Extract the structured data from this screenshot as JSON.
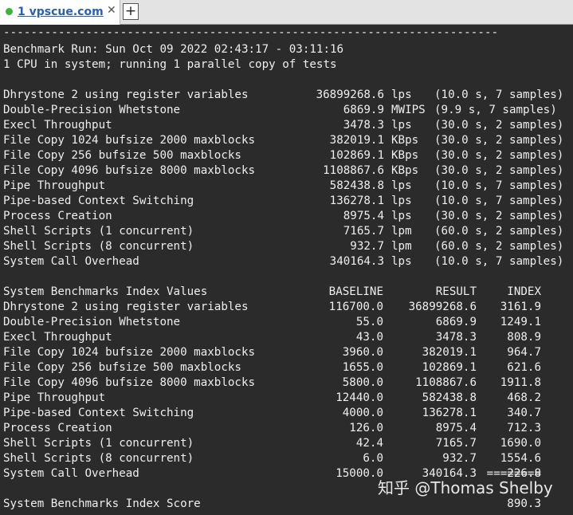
{
  "tab": {
    "title": "1 vpscue.com",
    "close": "✕",
    "new_tab": "+"
  },
  "header": {
    "separator": "------------------------------------------------------------------------",
    "run_line": "Benchmark Run: Sun Oct 09 2022 02:43:17 - 03:11:16",
    "cpu_line": "1 CPU in system; running 1 parallel copy of tests"
  },
  "results": [
    {
      "name": "Dhrystone 2 using register variables",
      "value": "36899268.6",
      "unit": "lps",
      "detail": "(10.0 s, 7 samples)"
    },
    {
      "name": "Double-Precision Whetstone",
      "value": "6869.9",
      "unit": "MWIPS",
      "detail": "(9.9 s, 7 samples)"
    },
    {
      "name": "Execl Throughput",
      "value": "3478.3",
      "unit": "lps",
      "detail": "(30.0 s, 2 samples)"
    },
    {
      "name": "File Copy 1024 bufsize 2000 maxblocks",
      "value": "382019.1",
      "unit": "KBps",
      "detail": "(30.0 s, 2 samples)"
    },
    {
      "name": "File Copy 256 bufsize 500 maxblocks",
      "value": "102869.1",
      "unit": "KBps",
      "detail": "(30.0 s, 2 samples)"
    },
    {
      "name": "File Copy 4096 bufsize 8000 maxblocks",
      "value": "1108867.6",
      "unit": "KBps",
      "detail": "(30.0 s, 2 samples)"
    },
    {
      "name": "Pipe Throughput",
      "value": "582438.8",
      "unit": "lps",
      "detail": "(10.0 s, 7 samples)"
    },
    {
      "name": "Pipe-based Context Switching",
      "value": "136278.1",
      "unit": "lps",
      "detail": "(10.0 s, 7 samples)"
    },
    {
      "name": "Process Creation",
      "value": "8975.4",
      "unit": "lps",
      "detail": "(30.0 s, 2 samples)"
    },
    {
      "name": "Shell Scripts (1 concurrent)",
      "value": "7165.7",
      "unit": "lpm",
      "detail": "(60.0 s, 2 samples)"
    },
    {
      "name": "Shell Scripts (8 concurrent)",
      "value": "932.7",
      "unit": "lpm",
      "detail": "(60.0 s, 2 samples)"
    },
    {
      "name": "System Call Overhead",
      "value": "340164.3",
      "unit": "lps",
      "detail": "(10.0 s, 7 samples)"
    }
  ],
  "index_header": {
    "title": "System Benchmarks Index Values",
    "baseline": "BASELINE",
    "result": "RESULT",
    "index": "INDEX"
  },
  "index_rows": [
    {
      "name": "Dhrystone 2 using register variables",
      "baseline": "116700.0",
      "result": "36899268.6",
      "index": "3161.9"
    },
    {
      "name": "Double-Precision Whetstone",
      "baseline": "55.0",
      "result": "6869.9",
      "index": "1249.1"
    },
    {
      "name": "Execl Throughput",
      "baseline": "43.0",
      "result": "3478.3",
      "index": "808.9"
    },
    {
      "name": "File Copy 1024 bufsize 2000 maxblocks",
      "baseline": "3960.0",
      "result": "382019.1",
      "index": "964.7"
    },
    {
      "name": "File Copy 256 bufsize 500 maxblocks",
      "baseline": "1655.0",
      "result": "102869.1",
      "index": "621.6"
    },
    {
      "name": "File Copy 4096 bufsize 8000 maxblocks",
      "baseline": "5800.0",
      "result": "1108867.6",
      "index": "1911.8"
    },
    {
      "name": "Pipe Throughput",
      "baseline": "12440.0",
      "result": "582438.8",
      "index": "468.2"
    },
    {
      "name": "Pipe-based Context Switching",
      "baseline": "4000.0",
      "result": "136278.1",
      "index": "340.7"
    },
    {
      "name": "Process Creation",
      "baseline": "126.0",
      "result": "8975.4",
      "index": "712.3"
    },
    {
      "name": "Shell Scripts (1 concurrent)",
      "baseline": "42.4",
      "result": "7165.7",
      "index": "1690.0"
    },
    {
      "name": "Shell Scripts (8 concurrent)",
      "baseline": "6.0",
      "result": "932.7",
      "index": "1554.6"
    },
    {
      "name": "System Call Overhead",
      "baseline": "15000.0",
      "result": "340164.3",
      "index": "226.8"
    }
  ],
  "score": {
    "separator": "========",
    "label": "System Benchmarks Index Score",
    "value": "890.3"
  },
  "watermark": "知乎 @Thomas Shelby",
  "colors": {
    "background": "#2b2b2b",
    "text": "#eeeeee",
    "tab_link": "#2a5fb8",
    "status_dot": "#3cb33c"
  }
}
